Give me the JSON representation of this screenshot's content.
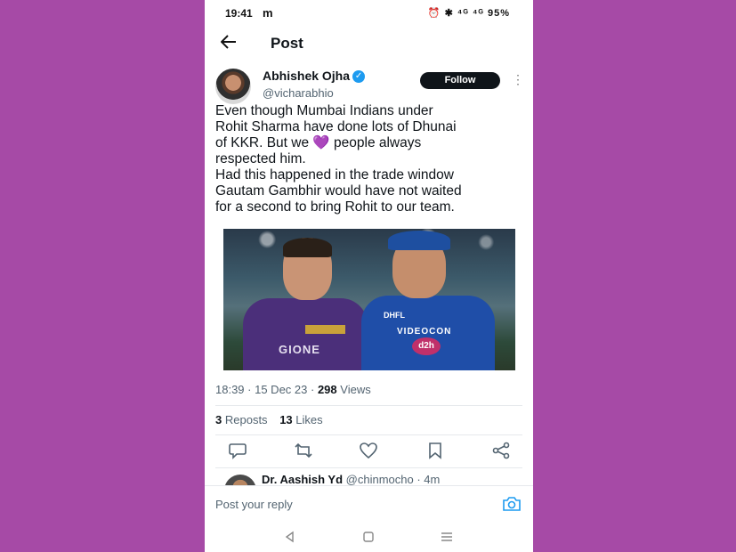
{
  "status_bar": {
    "time": "19:41",
    "carrier": "m",
    "icons": "⏰ ✱ ⁴ᴳ ⁴ᴳ",
    "battery": "95%"
  },
  "header": {
    "title": "Post"
  },
  "author": {
    "name": "Abhishek Ojha",
    "handle": "@vicharabhio",
    "verified": true
  },
  "follow_label": "Follow",
  "tweet": {
    "text": "Even though Mumbai Indians under\nRohit Sharma have done lots of Dhunai\nof KKR. But we 💜 people always\nrespected him.\nHad this happened in the trade window\nGautam Gambhir would have not waited\nfor a second to bring Rohit to our team.",
    "photo_text": {
      "sponsor1": "GIONE",
      "sponsor2": "VIDEOCON",
      "sponsor3": "d2h",
      "sponsor4": "DHFL"
    }
  },
  "meta": {
    "time": "18:39",
    "date": "15 Dec 23",
    "views_count": "298",
    "views_label": "Views"
  },
  "stats": {
    "reposts_count": "3",
    "reposts_label": "Reposts",
    "likes_count": "13",
    "likes_label": "Likes"
  },
  "reply_preview": {
    "name": "Dr. Aashish Yd",
    "handle": "@chinmocho · 4m"
  },
  "reply_input": {
    "placeholder": "Post your reply"
  },
  "colors": {
    "background": "#a64aa6",
    "follow_button": "#0f1419",
    "verified": "#1d9bf0",
    "accent": "#1d9bf0"
  }
}
